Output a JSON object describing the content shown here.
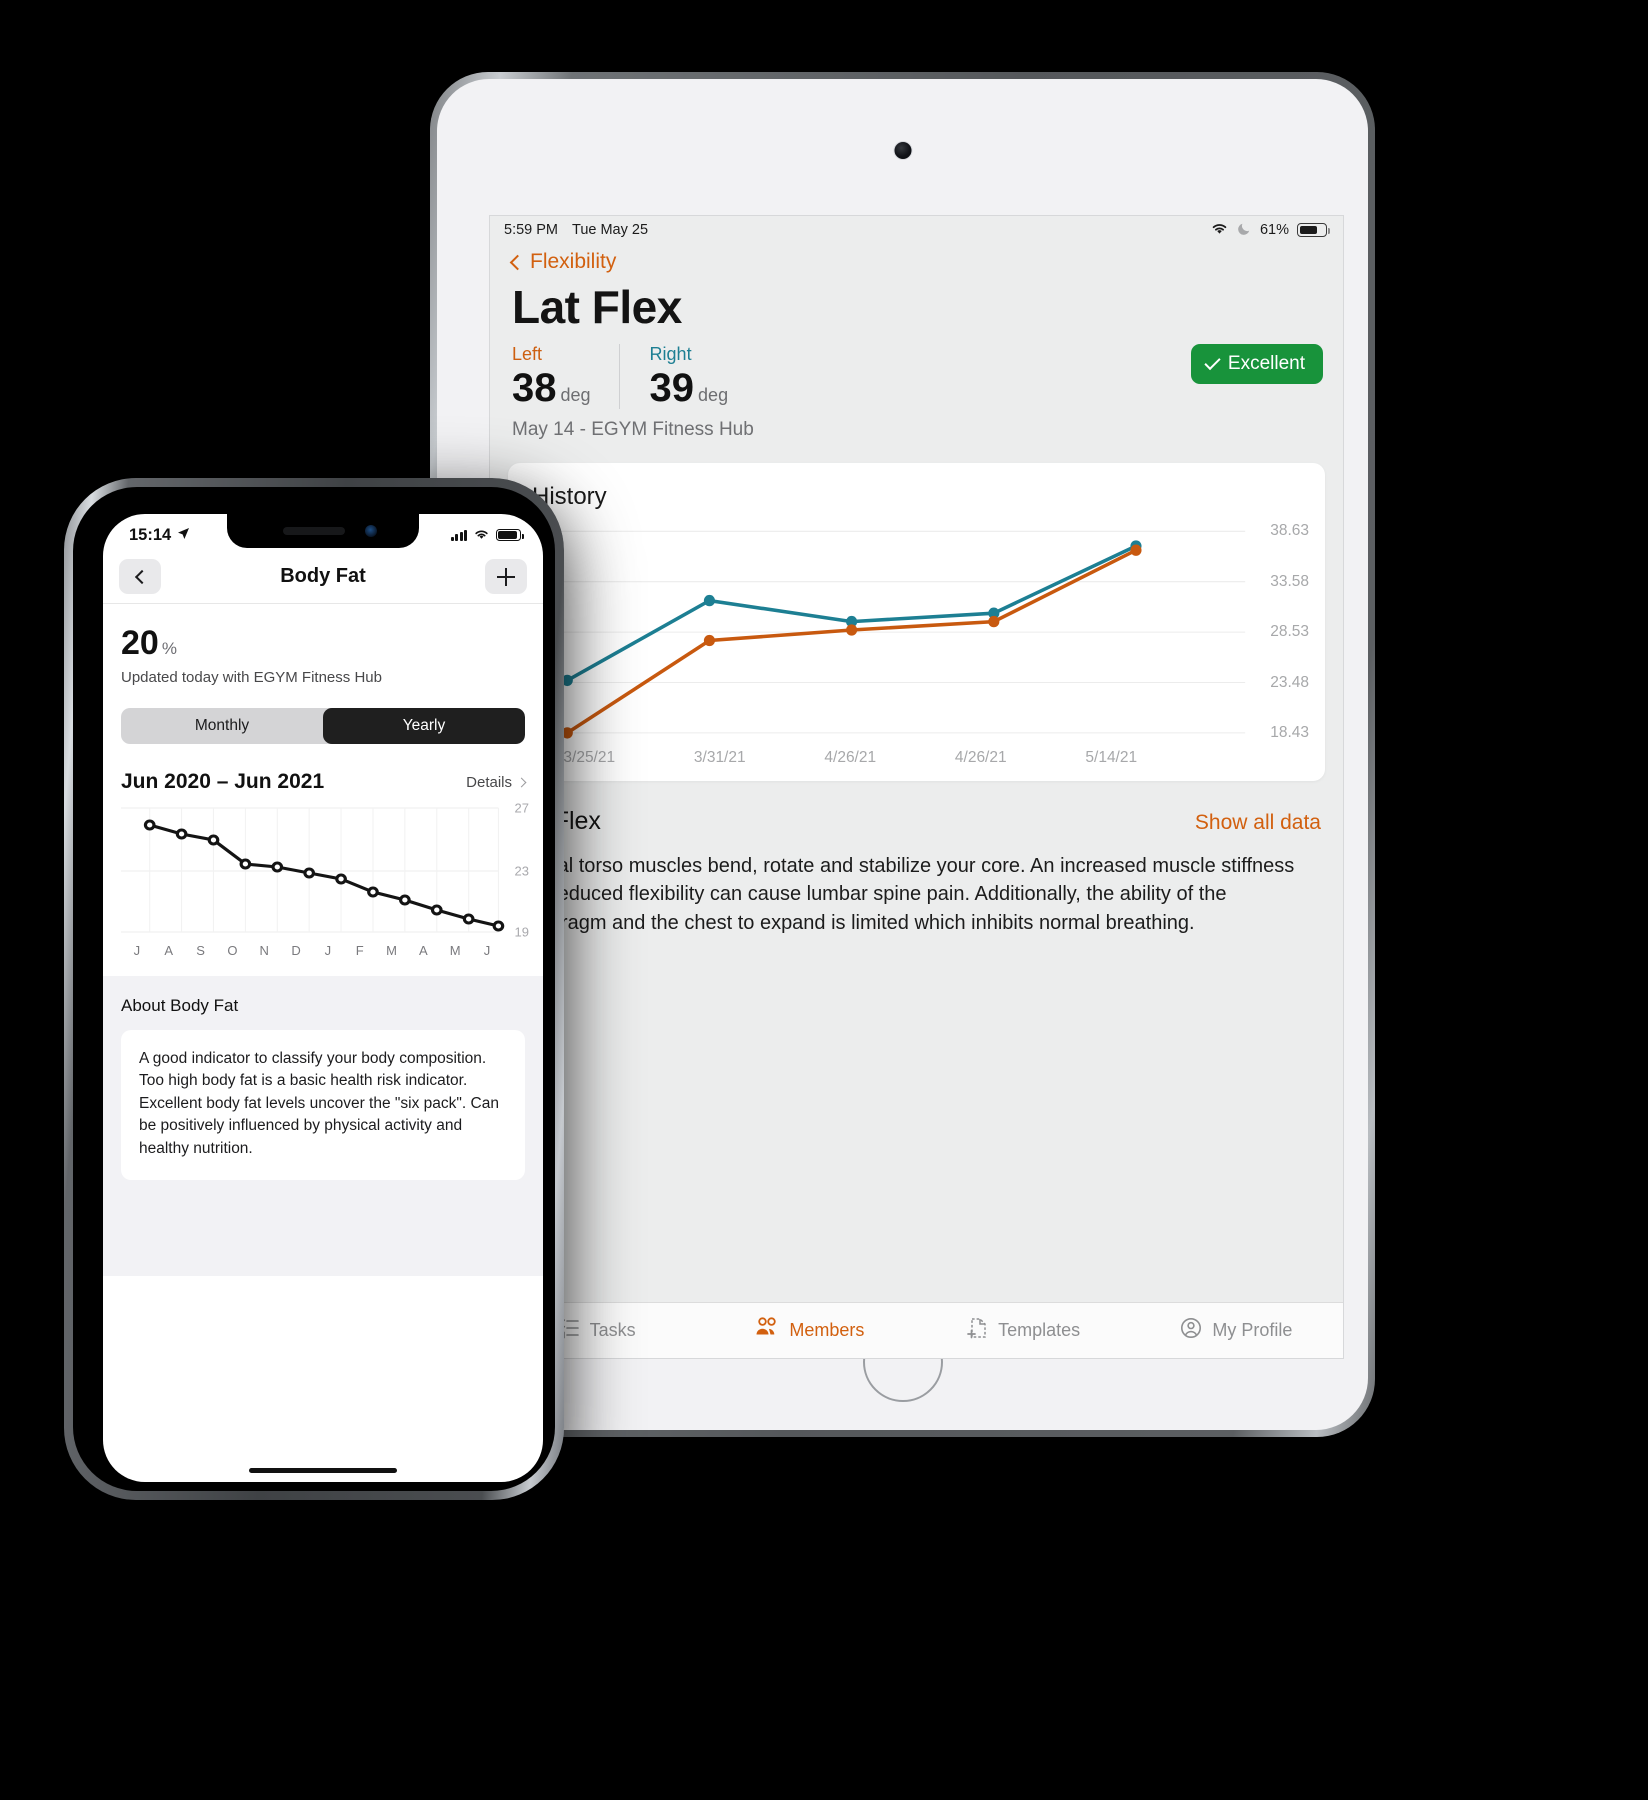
{
  "tablet": {
    "status": {
      "time": "5:59 PM",
      "date": "Tue May 25",
      "battery_pct": "61%"
    },
    "back_label": "Flexibility",
    "title": "Lat Flex",
    "metrics": [
      {
        "label": "Left",
        "value": "38",
        "unit": "deg",
        "color": "#cd5f10"
      },
      {
        "label": "Right",
        "value": "39",
        "unit": "deg",
        "color": "#1d7f93"
      }
    ],
    "badge": "Excellent",
    "badge_color": "#18933b",
    "subtitle": "May 14 - EGYM Fitness Hub",
    "history_card_title": "History",
    "description_title": "Lat Flex",
    "description_link": "Show all data",
    "description_body": "Lateral torso muscles bend, rotate and stabilize your core. An increased muscle stiffness and reduced flexibility can cause lumbar spine pain. Additionally, the ability of the diaphragm and the chest to expand is limited which inhibits normal breathing.",
    "tabs": [
      {
        "label": "Tasks",
        "icon": "tasks-icon",
        "active": false
      },
      {
        "label": "Members",
        "icon": "members-icon",
        "active": true
      },
      {
        "label": "Templates",
        "icon": "templates-icon",
        "active": false
      },
      {
        "label": "My Profile",
        "icon": "profile-icon",
        "active": false
      }
    ]
  },
  "phone": {
    "status": {
      "time": "15:14"
    },
    "nav_title": "Body Fat",
    "value": "20",
    "unit": "%",
    "updated": "Updated today with EGYM Fitness Hub",
    "segments": [
      {
        "label": "Monthly",
        "selected": false
      },
      {
        "label": "Yearly",
        "selected": true
      }
    ],
    "range_title": "Jun 2020 – Jun 2021",
    "details_label": "Details",
    "about_title": "About Body Fat",
    "about_body": "A good indicator to classify your body composition. Too high body fat is a basic health risk indicator. Excellent body fat levels uncover the \"six pack\". Can be positively influenced by physical activity and healthy nutrition."
  },
  "chart_data": [
    {
      "id": "tablet_history",
      "type": "line",
      "title": "History",
      "xlabel": "",
      "ylabel": "",
      "grid": true,
      "legend": [
        "Left",
        "Right"
      ],
      "categories": [
        "3/25/21",
        "3/31/21",
        "4/26/21",
        "4/26/21",
        "5/14/21"
      ],
      "ylim": [
        18.43,
        38.63
      ],
      "yticks": [
        18.43,
        23.48,
        28.53,
        33.58,
        38.63
      ],
      "series": [
        {
          "name": "Right",
          "color": "#1d7f93",
          "values": [
            23.5,
            31.4,
            29.2,
            30.1,
            38.9
          ]
        },
        {
          "name": "Left",
          "color": "#c8590f",
          "values": [
            18.5,
            26.6,
            28.6,
            29.6,
            38.6
          ]
        }
      ]
    },
    {
      "id": "phone_body_fat",
      "type": "line",
      "title": "Jun 2020 – Jun 2021",
      "xlabel": "",
      "ylabel": "",
      "grid": true,
      "categories": [
        "J",
        "A",
        "S",
        "O",
        "N",
        "D",
        "J",
        "F",
        "M",
        "A",
        "M",
        "J"
      ],
      "ylim": [
        19,
        27
      ],
      "yticks": [
        19,
        23,
        27
      ],
      "series": [
        {
          "name": "Body Fat",
          "color": "#141414",
          "values": [
            25.9,
            25.3,
            24.9,
            23.4,
            23.2,
            22.8,
            22.4,
            21.6,
            21.1,
            20.5,
            20.0,
            19.6
          ]
        }
      ]
    }
  ]
}
